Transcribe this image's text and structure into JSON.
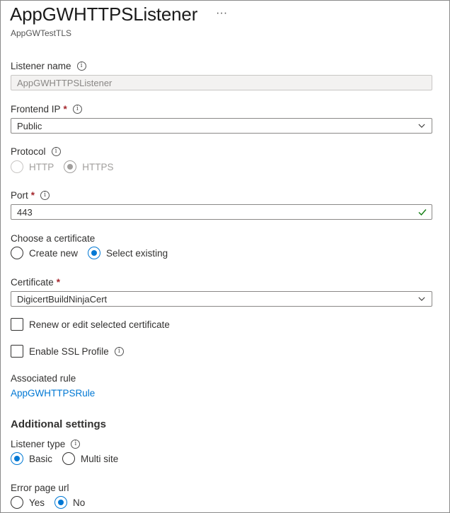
{
  "header": {
    "title": "AppGWHTTPSListener",
    "more_label": "···",
    "subtitle": "AppGWTestTLS"
  },
  "listener_name": {
    "label": "Listener name",
    "value": "AppGWHTTPSListener"
  },
  "frontend_ip": {
    "label": "Frontend IP",
    "required_mark": "*",
    "value": "Public"
  },
  "protocol": {
    "label": "Protocol",
    "options": [
      "HTTP",
      "HTTPS"
    ],
    "selected": "HTTPS"
  },
  "port": {
    "label": "Port",
    "required_mark": "*",
    "value": "443"
  },
  "choose_certificate": {
    "label": "Choose a certificate",
    "options": [
      "Create new",
      "Select existing"
    ],
    "selected": "Select existing"
  },
  "certificate": {
    "label": "Certificate",
    "required_mark": "*",
    "value": "DigicertBuildNinjaCert"
  },
  "renew_checkbox": {
    "label": "Renew or edit selected certificate",
    "checked": false
  },
  "ssl_profile_checkbox": {
    "label": "Enable SSL Profile",
    "checked": false
  },
  "associated_rule": {
    "label": "Associated rule",
    "link": "AppGWHTTPSRule"
  },
  "additional_settings": {
    "heading": "Additional settings",
    "listener_type": {
      "label": "Listener type",
      "options": [
        "Basic",
        "Multi site"
      ],
      "selected": "Basic"
    },
    "error_page_url": {
      "label": "Error page url",
      "options": [
        "Yes",
        "No"
      ],
      "selected": "No"
    }
  },
  "icons": {
    "info": "info-icon",
    "dropdown": "chevron-down-icon",
    "valid": "checkmark-icon"
  },
  "colors": {
    "accent": "#0078d4",
    "required": "#a4262c",
    "valid": "#107c10"
  }
}
